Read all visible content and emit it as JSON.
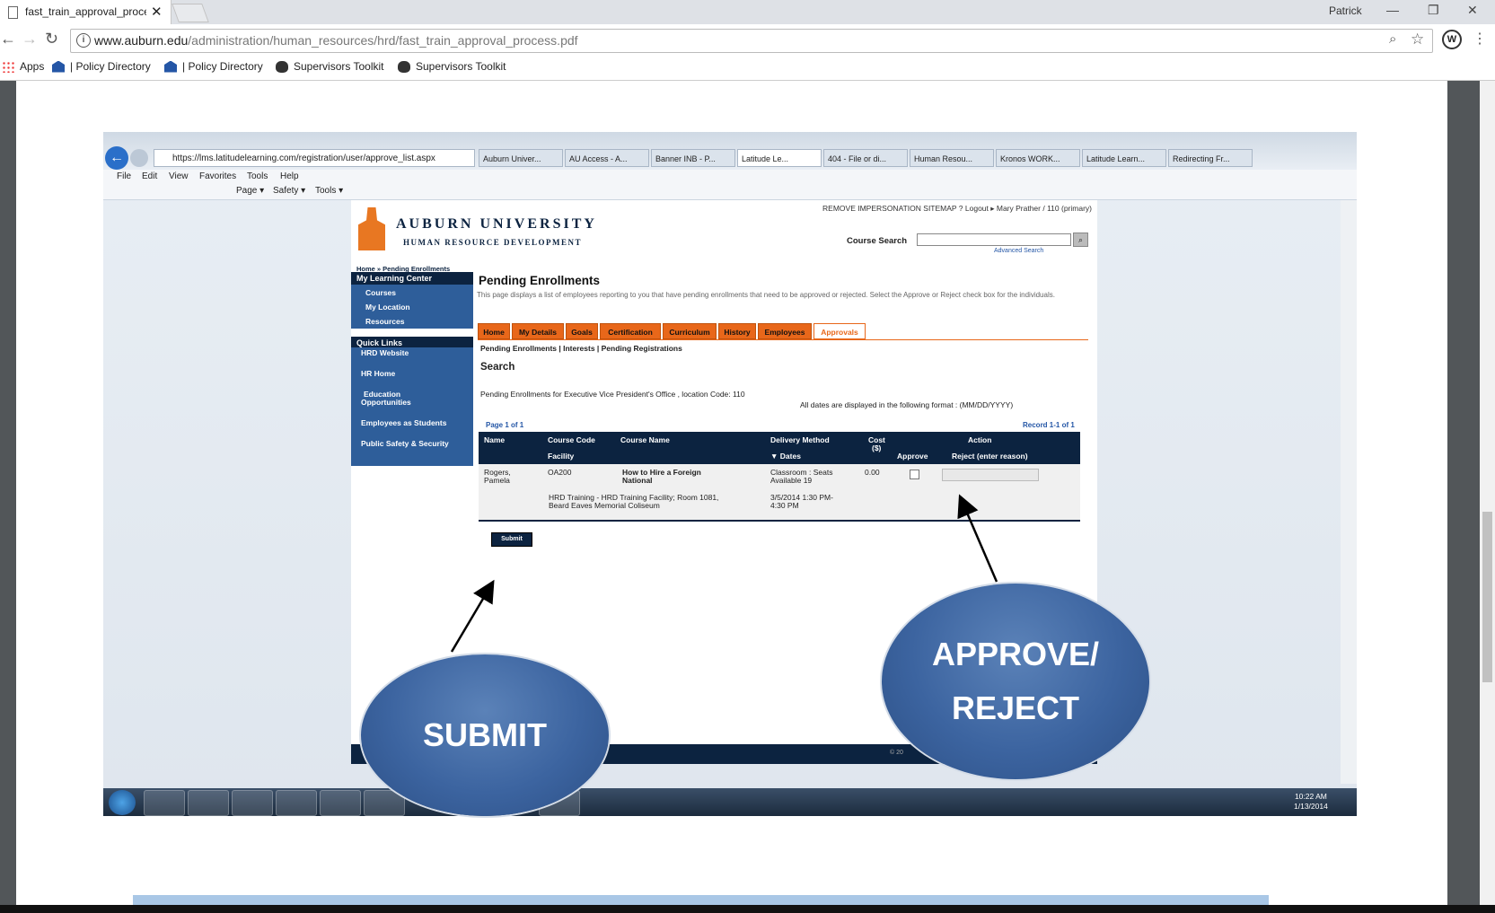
{
  "browser": {
    "tab_title": "fast_train_approval_process.pdf",
    "profile_name": "Patrick",
    "url_domain": "www.auburn.edu",
    "url_path": "/administration/human_resources/hrd/fast_train_approval_process.pdf",
    "bookmarks": [
      {
        "label": "Apps",
        "icon": "apps-grid-icon"
      },
      {
        "label": "| Policy Directory",
        "icon": "building-icon"
      },
      {
        "label": "| Policy Directory",
        "icon": "building-icon"
      },
      {
        "label": "Supervisors Toolkit",
        "icon": "tiger-icon"
      },
      {
        "label": "Supervisors Toolkit",
        "icon": "tiger-icon"
      }
    ]
  },
  "ie": {
    "address": "https://lms.latitudelearning.com/registration/user/approve_list.aspx",
    "tabs": [
      "Auburn Univer...",
      "AU Access - A...",
      "Banner INB - P...",
      "Latitude Le...",
      "404 - File or di...",
      "Human Resou...",
      "Kronos WORK...",
      "Latitude Learn...",
      "Redirecting Fr..."
    ],
    "menu": [
      "File",
      "Edit",
      "View",
      "Favorites",
      "Tools",
      "Help"
    ],
    "commands": [
      "Page ▾",
      "Safety ▾",
      "Tools ▾"
    ]
  },
  "lms": {
    "top_links": "REMOVE IMPERSONATION   SITEMAP   ?   Logout   ▸ Mary Prather / 110 (primary)",
    "logo_name": "AUBURN UNIVERSITY",
    "logo_dept": "HUMAN RESOURCE DEVELOPMENT",
    "course_search_label": "Course Search",
    "advanced_search": "Advanced Search",
    "breadcrumb": "Home » Pending Enrollments",
    "sidebar_head_1": "My Learning Center",
    "sidebar_items_1": [
      "Courses",
      "My Location",
      "Resources"
    ],
    "sidebar_head_2": "Quick Links",
    "sidebar_items_2": [
      "HRD Website",
      "HR Home",
      "Education",
      "Opportunities",
      "Employees as Students",
      "Public Safety & Security"
    ],
    "page_title": "Pending Enrollments",
    "page_desc": "This page displays a list of employees reporting to you that have pending enrollments that need to be approved or rejected. Select the Approve or Reject check box for the individuals.",
    "tabs": [
      "Home",
      "My Details",
      "Goals",
      "Certification",
      "Curriculum",
      "History",
      "Employees",
      "Approvals"
    ],
    "subtabs": "Pending Enrollments | Interests | Pending Registrations",
    "search_heading": "Search",
    "pending_for": "Pending Enrollments for Executive Vice President's Office , location Code: 110",
    "dates_format": "All dates are displayed in the following format : (MM/DD/YYYY)",
    "page_info": "Page 1 of 1",
    "record_info": "Record 1-1 of 1",
    "columns": {
      "name": "Name",
      "course_code": "Course Code",
      "facility": "Facility",
      "course_name": "Course Name",
      "delivery": "Delivery Method",
      "dates": "▼ Dates",
      "cost": "Cost",
      "cost_unit": "($)",
      "action": "Action",
      "approve": "Approve",
      "reject": "Reject (enter reason)"
    },
    "row": {
      "name_1": "Rogers,",
      "name_2": "Pamela",
      "code": "OA200",
      "course_1": "How to Hire a Foreign",
      "course_2": "National",
      "delivery_1": "Classroom : Seats",
      "delivery_2": "Available 19",
      "cost": "0.00",
      "facility_1": "HRD Training - HRD Training Facility; Room 1081,",
      "facility_2": "Beard Eaves Memorial Coliseum",
      "dates_1": "3/5/2014 1:30 PM-",
      "dates_2": "4:30 PM"
    },
    "submit_label": "Submit",
    "footer": "© 20"
  },
  "taskbar": {
    "time": "10:22 AM",
    "date": "1/13/2014"
  },
  "callouts": {
    "submit": "SUBMIT",
    "approve_1": "APPROVE/",
    "approve_2": "REJECT"
  },
  "colors": {
    "auburn_navy": "#0c2340",
    "auburn_orange": "#e87722",
    "callout_blue": "#3c64a0"
  }
}
